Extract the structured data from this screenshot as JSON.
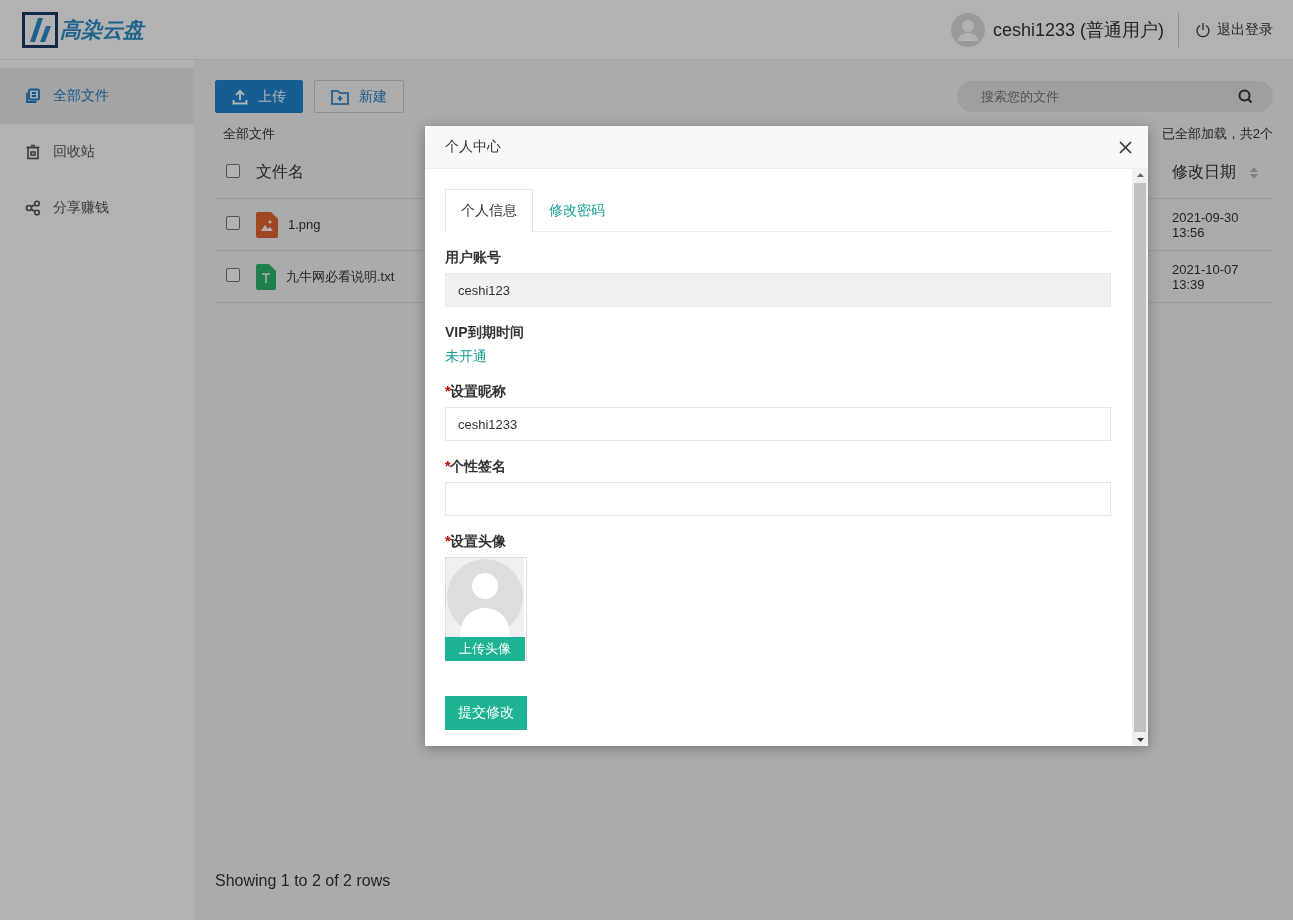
{
  "header": {
    "logo": "高染云盘",
    "user": "ceshi1233 (普通用户)",
    "logout": "退出登录"
  },
  "sidebar": {
    "items": [
      {
        "label": "全部文件",
        "kind": "files",
        "selected": true
      },
      {
        "label": "回收站",
        "kind": "trash",
        "selected": false
      },
      {
        "label": "分享赚钱",
        "kind": "share",
        "selected": false
      }
    ]
  },
  "toolbar": {
    "buttons": [
      {
        "label": "上传",
        "kind": "primary"
      },
      {
        "label": "新建",
        "kind": "default"
      }
    ],
    "search": {
      "placeholder": "搜索您的文件"
    }
  },
  "breadcrumb": "全部文件",
  "load_status": "已全部加载，共2个",
  "table": {
    "all_checked": false,
    "columns": [
      "文件名",
      "修改日期"
    ],
    "rows": [
      {
        "name": "1.png",
        "kind": "image",
        "date": "2021-09-30",
        "time": "13:56",
        "checked": false
      },
      {
        "name": "九牛网必看说明.txt",
        "kind": "text",
        "date": "2021-10-07",
        "time": "13:39",
        "checked": false
      }
    ]
  },
  "footer": "Showing 1 to 2 of 2 rows",
  "dialog": {
    "title": "个人中心",
    "tabs": [
      {
        "label": "个人信息",
        "selected": true
      },
      {
        "label": "修改密码",
        "selected": false
      }
    ],
    "fields": [
      {
        "kind": "readonly",
        "label": "用户账号",
        "value": "ceshi123"
      },
      {
        "kind": "text",
        "label": "VIP到期时间",
        "value": "未开通"
      },
      {
        "kind": "input",
        "mark": "*",
        "label": "设置昵称",
        "value": "ceshi1233"
      },
      {
        "kind": "input",
        "mark": "*",
        "label": "个性签名"
      },
      {
        "kind": "avatar",
        "mark": "*",
        "label": "设置头像",
        "button": "上传头像"
      }
    ],
    "submit": "提交修改"
  }
}
